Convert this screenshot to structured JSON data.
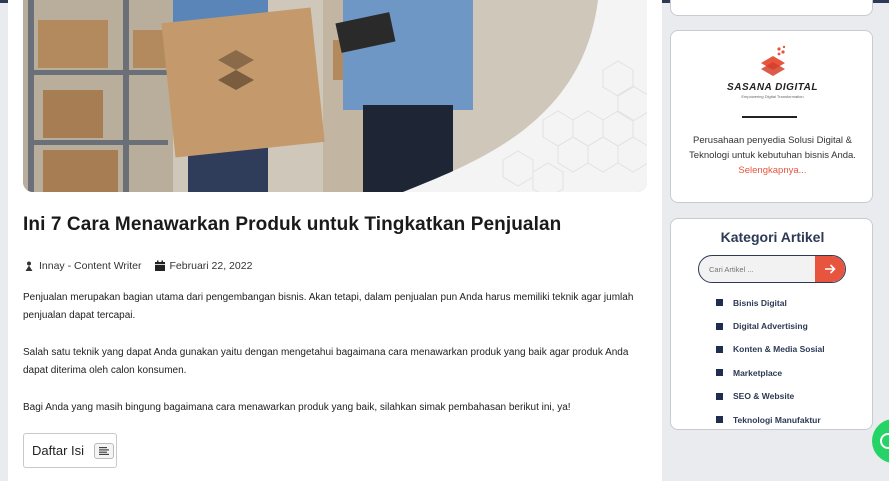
{
  "article": {
    "title": "Ini 7 Cara Menawarkan Produk untuk Tingkatkan Penjualan",
    "author": "Innay - Content Writer",
    "date": "Februari 22, 2022",
    "paragraphs": [
      "Penjualan merupakan bagian utama dari pengembangan bisnis. Akan tetapi, dalam penjualan pun Anda harus memiliki teknik agar jumlah penjualan dapat tercapai.",
      "Salah satu teknik yang dapat Anda gunakan yaitu dengan mengetahui bagaimana cara menawarkan produk yang baik agar produk Anda dapat diterima oleh calon konsumen.",
      "Bagi Anda yang masih bingung bagaimana cara menawarkan produk yang baik, silahkan simak pembahasan berikut ini, ya!"
    ],
    "toc_label": "Daftar Isi",
    "icons": {
      "author": "user-icon",
      "date": "calendar-icon",
      "toc": "list-icon"
    }
  },
  "sidebar": {
    "brand": {
      "name": "SASANA DIGITAL",
      "tagline": "Empowering Digital Transformation",
      "description": "Perusahaan penyedia Solusi Digital & Teknologi untuk kebutuhan bisnis Anda.",
      "more_link": "Selengkapnya...",
      "colors": {
        "accent": "#e8553e"
      }
    },
    "categories": {
      "title": "Kategori Artikel",
      "search_placeholder": "Cari Artikel ...",
      "items": [
        "Bisnis Digital",
        "Digital Advertising",
        "Konten & Media Sosial",
        "Marketplace",
        "SEO & Website",
        "Teknologi Manufaktur"
      ]
    }
  },
  "colors": {
    "navy": "#2d3a55",
    "accent": "#e8553e",
    "whatsapp": "#25d366"
  }
}
